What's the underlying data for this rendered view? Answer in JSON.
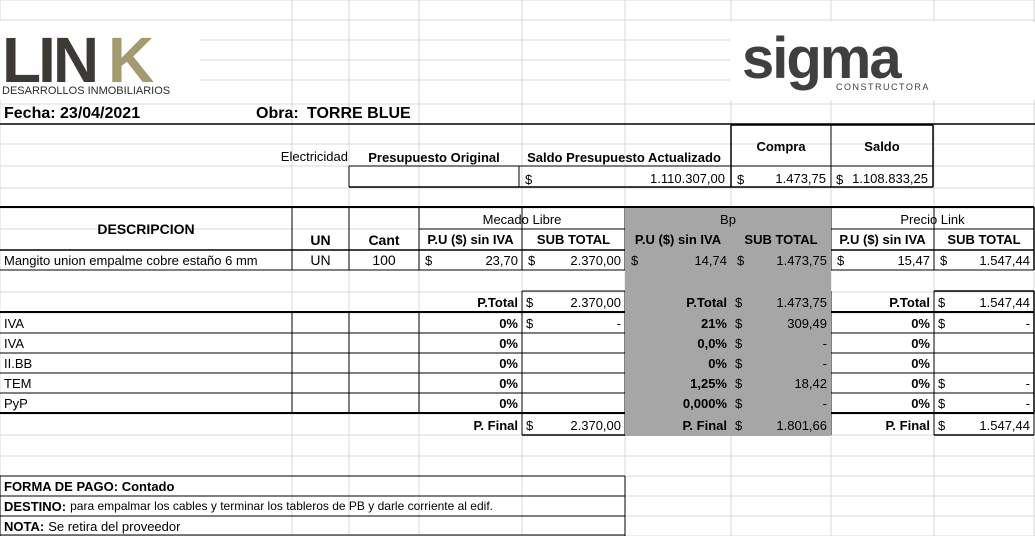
{
  "logos": {
    "link": {
      "word": "LINK",
      "subtitle": "DESARROLLOS INMOBILIARIOS",
      "colors": {
        "dark": "#3d3a35",
        "accent": "#a39a6e"
      }
    },
    "sigma": {
      "word": "sigma",
      "subtitle": "CONSTRUCTORA",
      "color": "#3f3f3f"
    }
  },
  "header": {
    "fecha": "Fecha: 23/04/2021",
    "obra_label": "Obra:",
    "obra_value": "TORRE BLUE"
  },
  "budget": {
    "rubro": "Electricidad",
    "col_presupuesto": "Presupuesto Original",
    "col_saldo_actualizado": "Saldo Presupuesto Actualizado",
    "col_compra": "Compra",
    "col_saldo": "Saldo",
    "saldo_actualizado_value": "1.110.307,00",
    "compra_value": "1.473,75",
    "saldo_value": "1.108.833,25",
    "currency": "$"
  },
  "table": {
    "descripcion": "DESCRIPCION",
    "un": "UN",
    "cant": "Cant",
    "groups": [
      "Mecado Libre",
      "Bp",
      "Precio Link"
    ],
    "pu": "P.U ($) sin IVA",
    "subtotal": "SUB TOTAL",
    "item": {
      "desc": "Mangito union empalme cobre estaño 6 mm",
      "un": "UN",
      "cant": "100",
      "ml_pu": "23,70",
      "ml_sub": "2.370,00",
      "bp_pu": "14,74",
      "bp_sub": "1.473,75",
      "pl_pu": "15,47",
      "pl_sub": "1.547,44"
    },
    "ptotal_label": "P.Total",
    "ptotal": {
      "ml": "2.370,00",
      "bp": "1.473,75",
      "pl": "1.547,44"
    },
    "taxes": [
      {
        "name": "IVA",
        "ml_pct": "0%",
        "ml_val": "-",
        "bp_pct": "21%",
        "bp_val": "309,49",
        "pl_pct": "0%",
        "pl_val": "-"
      },
      {
        "name": "IVA",
        "ml_pct": "0%",
        "ml_val": "",
        "bp_pct": "0,0%",
        "bp_val": "-",
        "pl_pct": "0%",
        "pl_val": ""
      },
      {
        "name": "II.BB",
        "ml_pct": "0%",
        "ml_val": "",
        "bp_pct": "0%",
        "bp_val": "-",
        "pl_pct": "0%",
        "pl_val": ""
      },
      {
        "name": "TEM",
        "ml_pct": "0%",
        "ml_val": "",
        "bp_pct": "1,25%",
        "bp_val": "18,42",
        "pl_pct": "0%",
        "pl_val": "-"
      },
      {
        "name": "PyP",
        "ml_pct": "0%",
        "ml_val": "",
        "bp_pct": "0,000%",
        "bp_val": "-",
        "pl_pct": "0%",
        "pl_val": "-"
      }
    ],
    "pfinal_label": "P. Final",
    "pfinal": {
      "ml": "2.370,00",
      "bp": "1.801,66",
      "pl": "1.547,44"
    }
  },
  "notes": {
    "forma_pago": "FORMA DE PAGO: Contado",
    "destino_label": "DESTINO:",
    "destino_text": "para empalmar los cables y terminar los tableros de PB y darle corriente al edif.",
    "nota_label": "NOTA:",
    "nota_text": "Se retira del proveedor"
  }
}
